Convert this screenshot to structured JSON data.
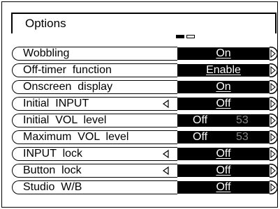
{
  "title": "Options",
  "page_indicator": {
    "current": 1,
    "total": 2
  },
  "items": [
    {
      "label": "Wobbling",
      "value": "On",
      "has_left_arrow": false,
      "kind": "text"
    },
    {
      "label": "Off-timer  function",
      "value": "Enable",
      "has_left_arrow": false,
      "kind": "text"
    },
    {
      "label": "Onscreen  display",
      "value": "On",
      "has_left_arrow": false,
      "kind": "text"
    },
    {
      "label": "Initial  INPUT",
      "value": "Off",
      "has_left_arrow": true,
      "kind": "text"
    },
    {
      "label": "Initial  VOL  level",
      "value": "Off",
      "number": "53",
      "has_left_arrow": false,
      "kind": "level"
    },
    {
      "label": "Maximum  VOL  level",
      "value": "Off",
      "number": "53",
      "has_left_arrow": false,
      "kind": "level"
    },
    {
      "label": "INPUT  lock",
      "value": "Off",
      "has_left_arrow": true,
      "kind": "text"
    },
    {
      "label": "Button  lock",
      "value": "Off",
      "has_left_arrow": true,
      "kind": "text"
    },
    {
      "label": "Studio  W/B",
      "value": "Off",
      "has_left_arrow": false,
      "kind": "text"
    }
  ]
}
